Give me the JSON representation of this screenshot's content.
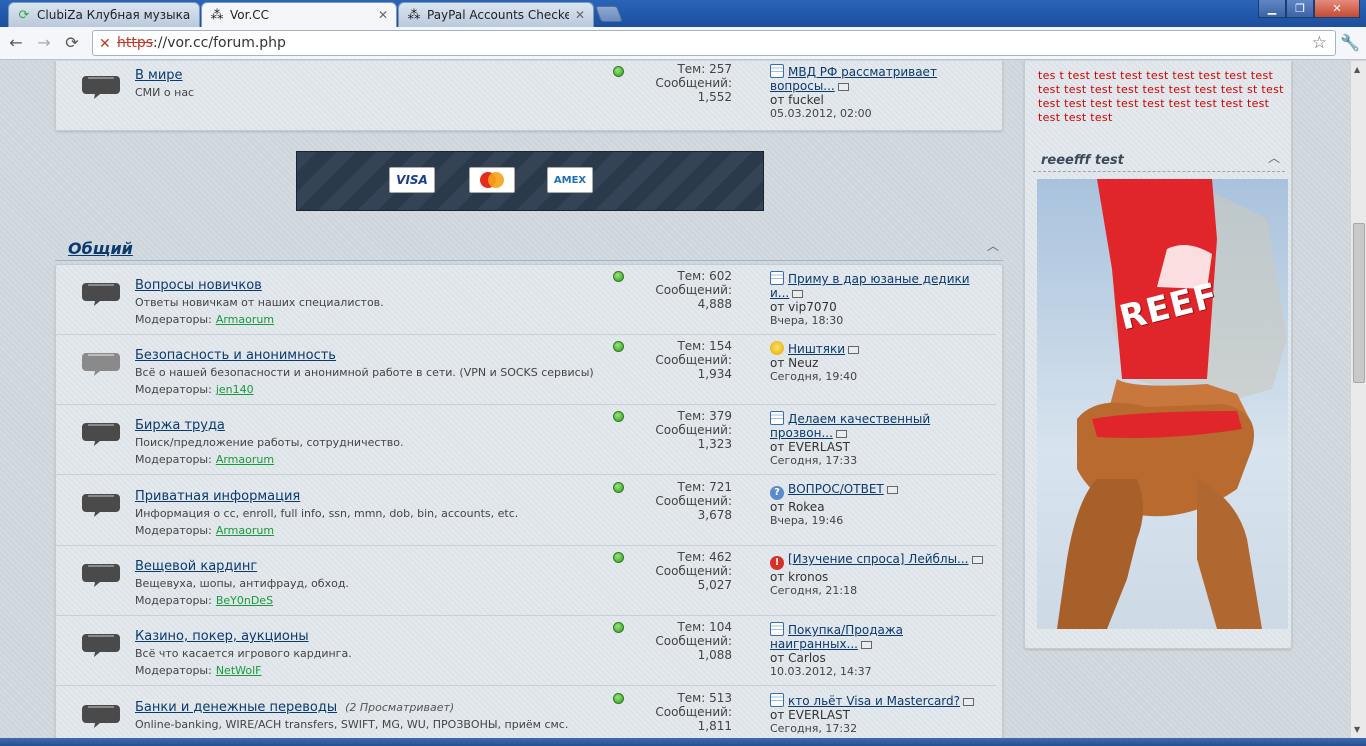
{
  "browser": {
    "tabs": [
      {
        "title": "ClubiZa Клубная музыка и",
        "active": false
      },
      {
        "title": "Vor.CC",
        "active": true
      },
      {
        "title": "PayPal Accounts Checker",
        "active": false
      }
    ],
    "url_scheme": "https",
    "url_rest": "://vor.cc/forum.php"
  },
  "section_top": {
    "forum": {
      "name": "В мире",
      "description": "СМИ о нас",
      "topics_label": "Тем: 257",
      "posts_label": "Сообщений:",
      "posts": "1,552",
      "last_title_1": "МВД РФ рассматривает",
      "last_title_2": "вопросы...",
      "last_by": "от fuckel",
      "last_date": "05.03.2012, 02:00"
    }
  },
  "banner": {
    "cards": [
      "VISA",
      "MC",
      "AMEX"
    ]
  },
  "section_general": {
    "title": "Общий",
    "moderators_label": "Модераторы:",
    "forums": [
      {
        "name": "Вопросы новичков",
        "viewers": "",
        "description": "Ответы новичкам от наших специалистов.",
        "moderator": "Armaorum",
        "topics": "Тем: 602",
        "posts_label": "Сообщений:",
        "posts": "4,888",
        "icon": "doc",
        "last_title_1": "Приму в дар юзаные дедики",
        "last_title_2": "и...",
        "last_by": "от vip7070",
        "last_date": "Вчера, 18:30"
      },
      {
        "name": "Безопасность и анонимность",
        "viewers": "",
        "description": "Всё о нашей безопасности и анонимной работе в сети. (VPN и SOCKS сервисы)",
        "moderator": "jen140",
        "topics": "Тем: 154",
        "posts_label": "Сообщений:",
        "posts": "1,934",
        "icon": "smile",
        "last_title_1": "Ништяки",
        "last_title_2": "",
        "last_by": "от Neuz",
        "last_date": "Сегодня, 19:40"
      },
      {
        "name": "Биржа труда",
        "viewers": "",
        "description": "Поиск/предложение работы, сотрудничество.",
        "moderator": "Armaorum",
        "topics": "Тем: 379",
        "posts_label": "Сообщений:",
        "posts": "1,323",
        "icon": "doc",
        "last_title_1": "Делаем качественный",
        "last_title_2": "прозвон...",
        "last_by": "от EVERLAST",
        "last_date": "Сегодня, 17:33"
      },
      {
        "name": "Приватная информация",
        "viewers": "",
        "description": "Информация о cc, enroll, full info, ssn, mmn, dob, bin, accounts, etc.",
        "moderator": "Armaorum",
        "topics": "Тем: 721",
        "posts_label": "Сообщений:",
        "posts": "3,678",
        "icon": "q",
        "last_title_1": "ВОПРОС/ОТВЕТ",
        "last_title_2": "",
        "last_by": "от Rokea",
        "last_date": "Вчера, 19:46"
      },
      {
        "name": "Вещевой кардинг",
        "viewers": "",
        "description": "Вещевуха, шопы, антифрауд, обход.",
        "moderator": "BeY0nDeS",
        "topics": "Тем: 462",
        "posts_label": "Сообщений:",
        "posts": "5,027",
        "icon": "ex",
        "last_title_1": "[Изучение спроса] Лейблы...",
        "last_title_2": "",
        "last_by": "от kronos",
        "last_date": "Сегодня, 21:18"
      },
      {
        "name": "Казино, покер, аукционы",
        "viewers": "",
        "description": "Всё что касается игрового кардинга.",
        "moderator": "NetWolF",
        "topics": "Тем: 104",
        "posts_label": "Сообщений:",
        "posts": "1,088",
        "icon": "doc",
        "last_title_1": "Покупка/Продажа",
        "last_title_2": "наигранных...",
        "last_by": "от Carlos",
        "last_date": "10.03.2012, 14:37"
      },
      {
        "name": "Банки и денежные переводы",
        "viewers": "(2 Просматривает)",
        "description": "Online-banking, WIRE/ACH transfers, SWIFT, MG, WU, ПРОЗВОНЫ, приём смс.",
        "moderator": "",
        "topics": "Тем: 513",
        "posts_label": "Сообщений:",
        "posts": "1,811",
        "icon": "doc",
        "last_title_1": "кто льёт Visa и Mastercard?",
        "last_title_2": "",
        "last_by": "от EVERLAST",
        "last_date": "Сегодня, 17:32"
      }
    ]
  },
  "sidebar": {
    "text": "tes t test test test test test test test test test test test test test test test test st test test test test test test test test test test test test test",
    "widget_title": "reeefff test",
    "image_caption": "REEF"
  }
}
